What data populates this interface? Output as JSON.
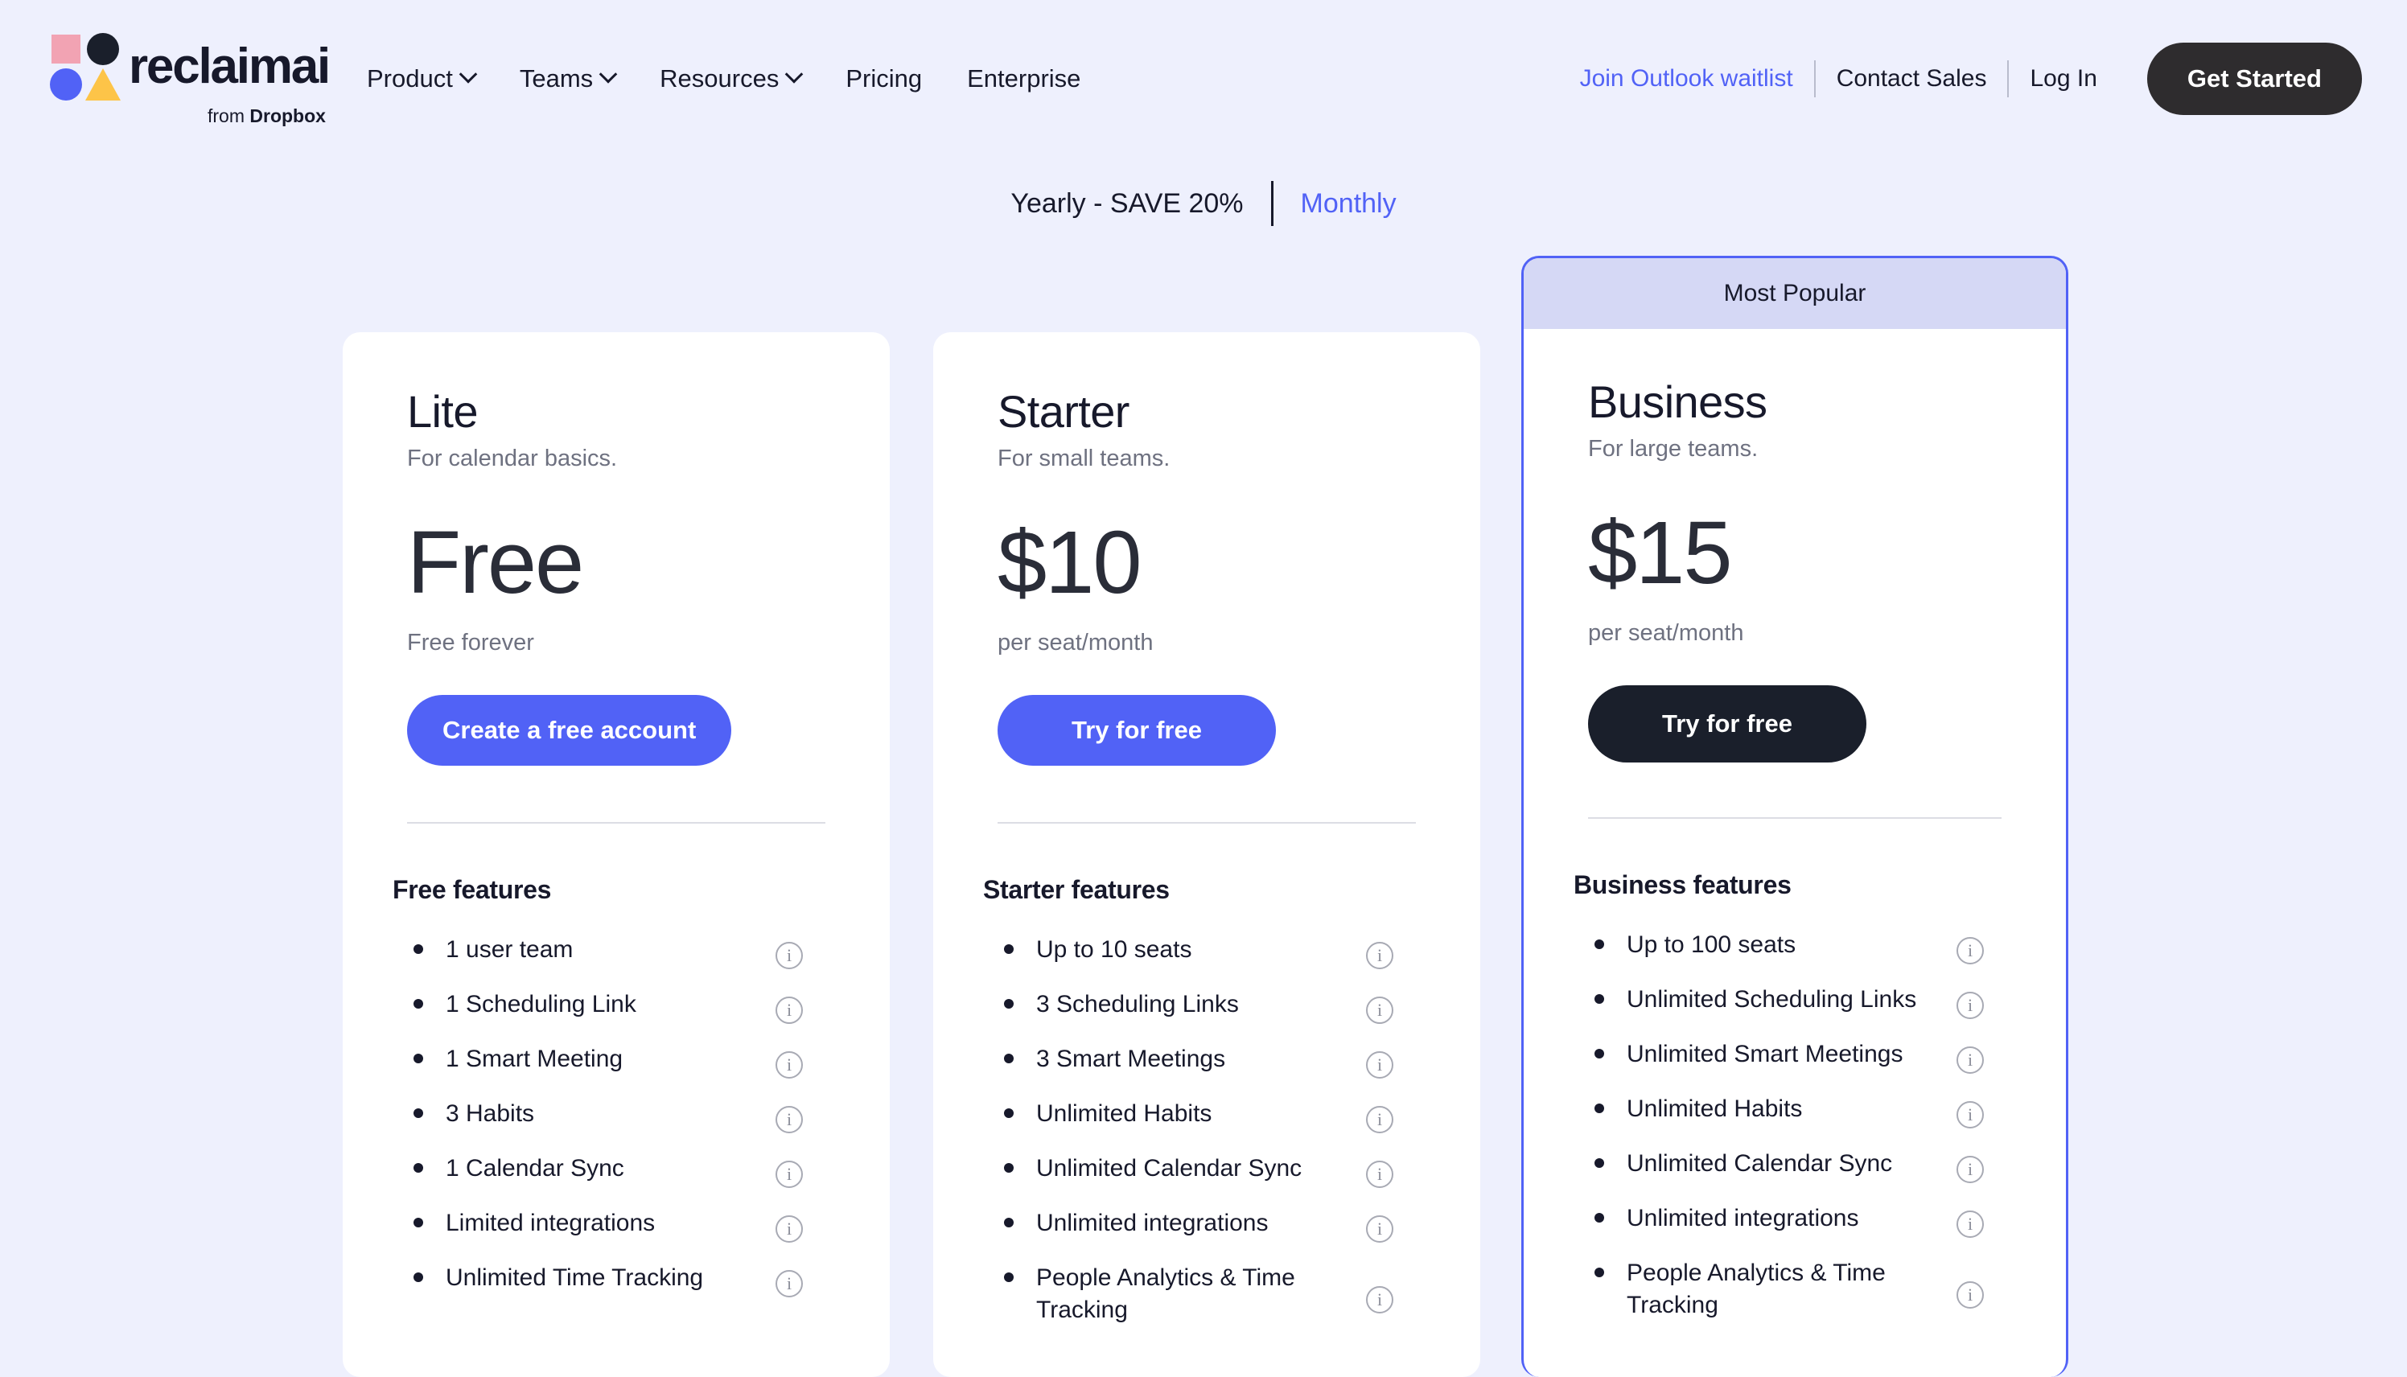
{
  "brand": {
    "name": "reclaimai",
    "sub_prefix": "from ",
    "sub_bold": "Dropbox",
    "logo_colors": {
      "square": "#f2a3b3",
      "circle_dark": "#1a1f2b",
      "circle_blue": "#5162f6",
      "triangle": "#fdc448"
    }
  },
  "nav": {
    "items": [
      {
        "label": "Product",
        "has_chevron": true
      },
      {
        "label": "Teams",
        "has_chevron": true
      },
      {
        "label": "Resources",
        "has_chevron": true
      },
      {
        "label": "Pricing",
        "has_chevron": false
      },
      {
        "label": "Enterprise",
        "has_chevron": false
      }
    ],
    "right": {
      "waitlist": "Join Outlook waitlist",
      "contact": "Contact Sales",
      "login": "Log In",
      "cta": "Get Started"
    }
  },
  "billing": {
    "yearly": "Yearly - SAVE 20%",
    "monthly": "Monthly",
    "selected": "Yearly - SAVE 20%"
  },
  "colors": {
    "page_bg": "#eef0fd",
    "accent": "#5162f6",
    "dark": "#1a1f2b",
    "badge_bg": "#d5d8f5"
  },
  "plans": [
    {
      "name": "Lite",
      "tagline": "For calendar basics.",
      "price": "Free",
      "period": "Free forever",
      "cta": "Create a free account",
      "features_title": "Free features",
      "features": [
        "1 user team",
        "1 Scheduling Link",
        "1 Smart Meeting",
        "3 Habits",
        "1 Calendar Sync",
        "Limited integrations",
        "Unlimited Time Tracking"
      ]
    },
    {
      "name": "Starter",
      "tagline": "For small teams.",
      "price": "$10",
      "period": "per seat/month",
      "cta": "Try for free",
      "features_title": "Starter features",
      "features": [
        "Up to 10 seats",
        "3 Scheduling Links",
        "3 Smart Meetings",
        "Unlimited Habits",
        "Unlimited Calendar Sync",
        "Unlimited integrations",
        "People Analytics & Time Tracking"
      ]
    },
    {
      "name": "Business",
      "tagline": "For large teams.",
      "price": "$15",
      "period": "per seat/month",
      "cta": "Try for free",
      "badge": "Most Popular",
      "features_title": "Business features",
      "features": [
        "Up to 100 seats",
        "Unlimited Scheduling Links",
        "Unlimited Smart Meetings",
        "Unlimited Habits",
        "Unlimited Calendar Sync",
        "Unlimited integrations",
        "People Analytics & Time Tracking"
      ]
    }
  ],
  "info_icon_glyph": "i"
}
